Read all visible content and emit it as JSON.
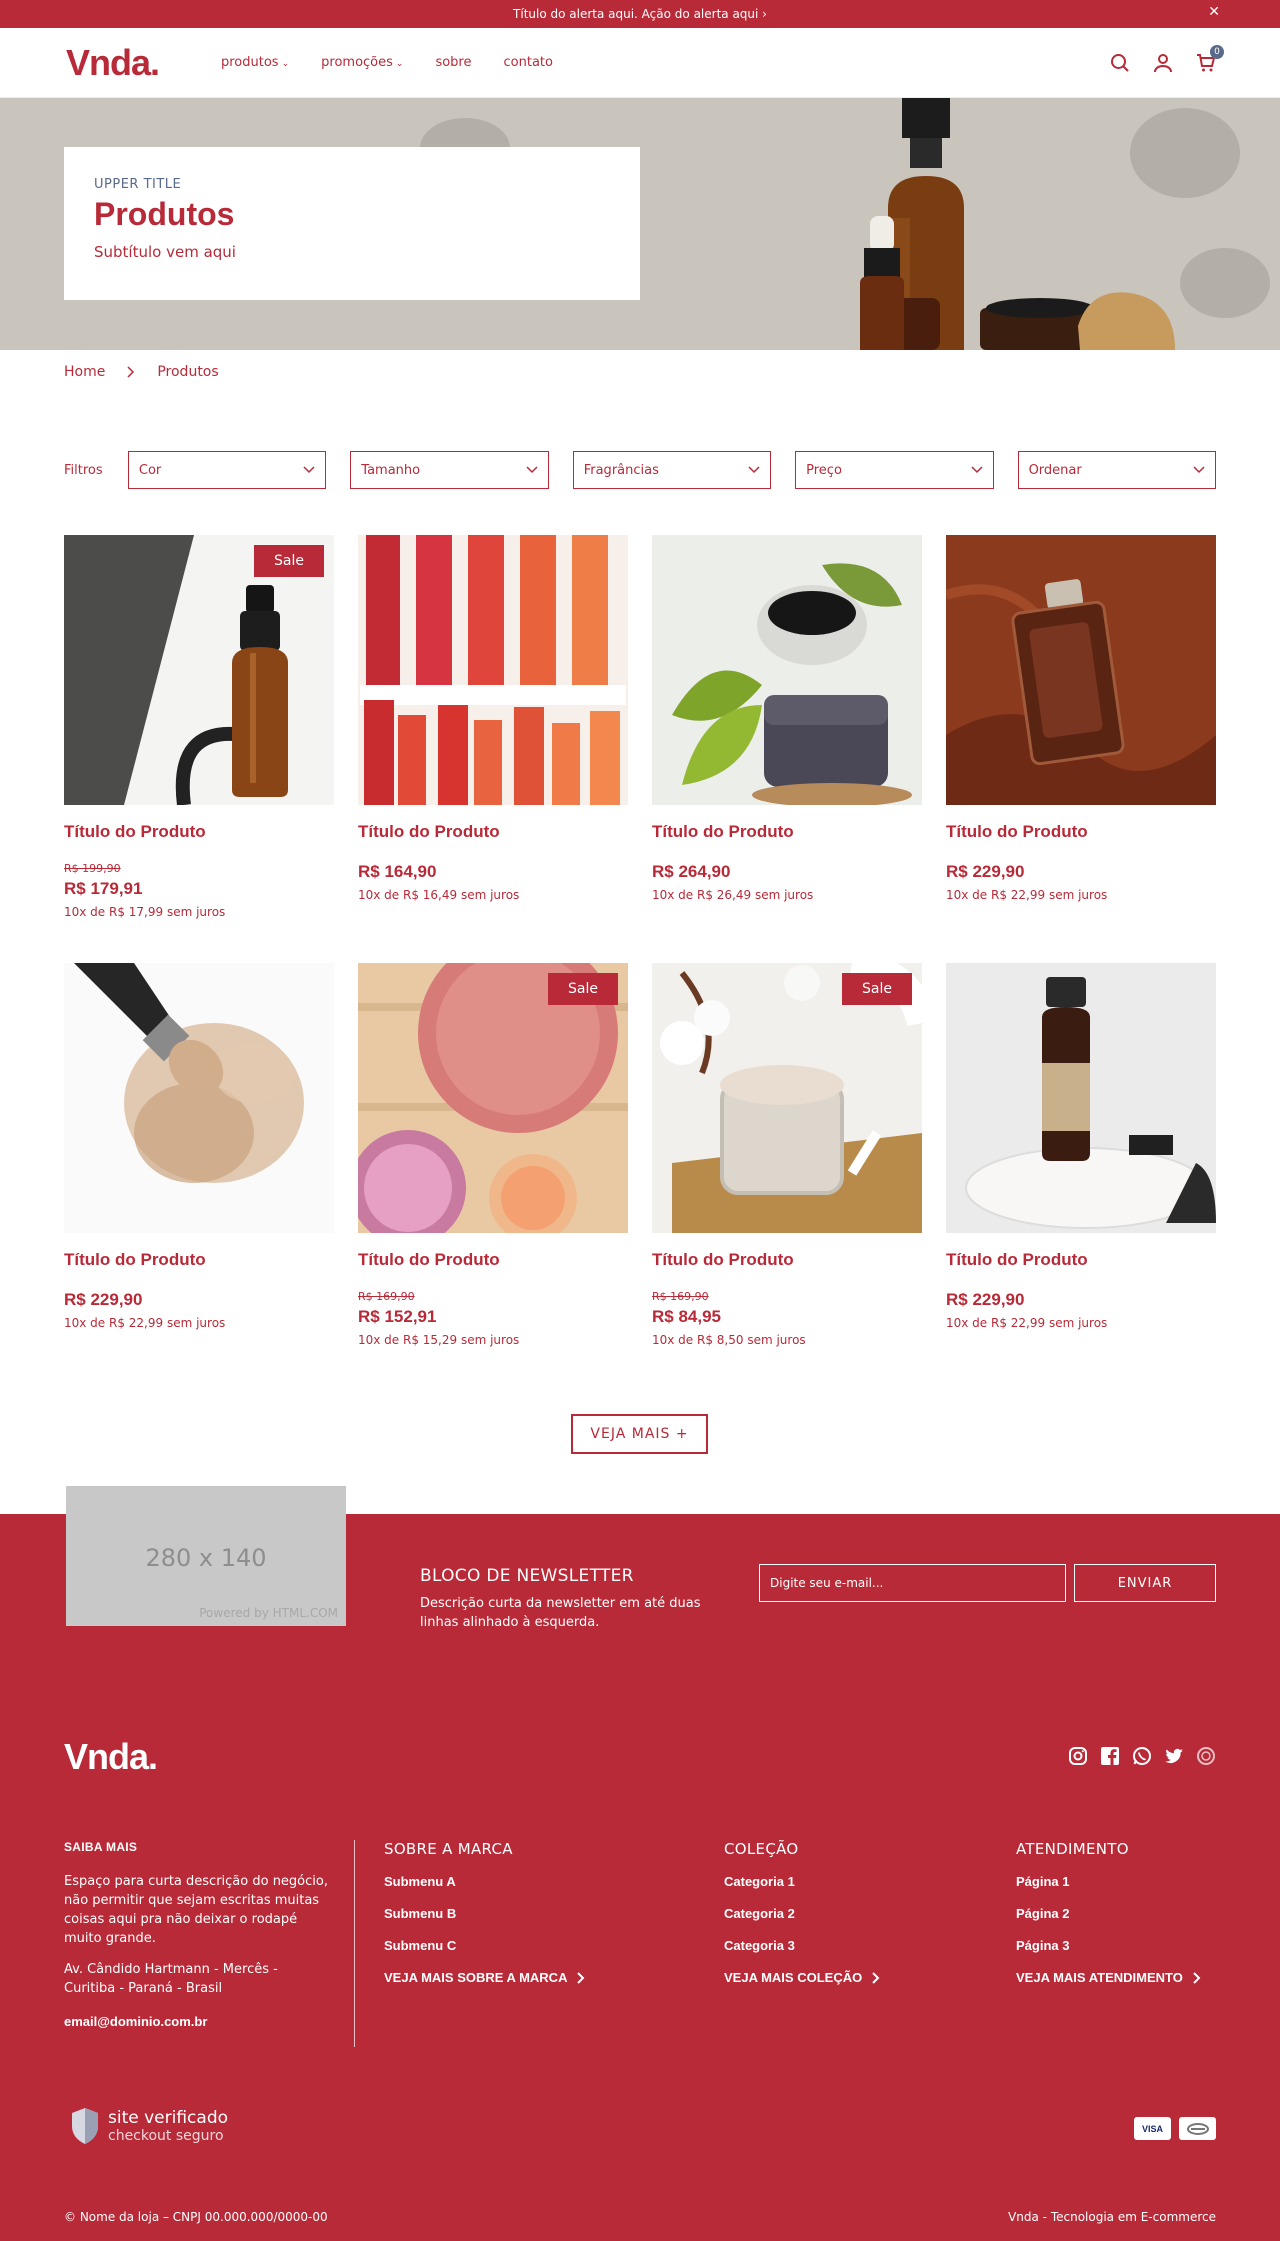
{
  "alert": {
    "text": "Título do alerta aqui. Ação do alerta aqui ›",
    "close": "✕"
  },
  "header": {
    "logo": "Vnda.",
    "nav": [
      {
        "label": "produtos",
        "dropdown": true
      },
      {
        "label": "promoções",
        "dropdown": true
      },
      {
        "label": "sobre",
        "dropdown": false
      },
      {
        "label": "contato",
        "dropdown": false
      }
    ],
    "cart_count": "0",
    "icons": [
      "search-icon",
      "user-icon",
      "cart-icon"
    ]
  },
  "hero": {
    "upper": "UPPER TITLE",
    "title": "Produtos",
    "subtitle": "Subtítulo vem aqui"
  },
  "breadcrumb": {
    "home": "Home",
    "current": "Produtos"
  },
  "filters": {
    "label": "Filtros",
    "items": [
      "Cor",
      "Tamanho",
      "Fragrâncias",
      "Preço",
      "Ordenar"
    ]
  },
  "products": [
    {
      "title": "Título do Produto",
      "sale": "Sale",
      "old_price": "R$ 199,90",
      "price": "R$ 179,91",
      "installments": "10x de R$ 17,99 sem juros",
      "image": "dropper-bottle"
    },
    {
      "title": "Título do Produto",
      "sale": "",
      "old_price": "",
      "price": "R$ 164,90",
      "installments": "10x de R$ 16,49 sem juros",
      "image": "lipsticks"
    },
    {
      "title": "Título do Produto",
      "sale": "",
      "old_price": "",
      "price": "R$ 264,90",
      "installments": "10x de R$ 26,49 sem juros",
      "image": "charcoal-soap"
    },
    {
      "title": "Título do Produto",
      "sale": "",
      "old_price": "",
      "price": "R$ 229,90",
      "installments": "10x de R$ 22,99 sem juros",
      "image": "perfume"
    },
    {
      "title": "Título do Produto",
      "sale": "",
      "old_price": "",
      "price": "R$ 229,90",
      "installments": "10x de R$ 22,99 sem juros",
      "image": "powder-brush"
    },
    {
      "title": "Título do Produto",
      "sale": "Sale",
      "old_price": "R$ 169,90",
      "price": "R$ 152,91",
      "installments": "10x de R$ 15,29 sem juros",
      "image": "pigments"
    },
    {
      "title": "Título do Produto",
      "sale": "Sale",
      "old_price": "R$ 169,90",
      "price": "R$ 84,95",
      "installments": "10x de R$ 8,50 sem juros",
      "image": "scrub-jar"
    },
    {
      "title": "Título do Produto",
      "sale": "",
      "old_price": "",
      "price": "R$ 229,90",
      "installments": "10x de R$ 22,99 sem juros",
      "image": "amber-bottle"
    }
  ],
  "more_button": "VEJA MAIS +",
  "newsletter": {
    "image_label": "280 x 140",
    "image_powered": "Powered by HTML.COM",
    "title": "BLOCO DE NEWSLETTER",
    "desc": "Descrição curta da newsletter em até duas linhas alinhado à esquerda.",
    "placeholder": "Digite seu e-mail...",
    "button": "ENVIAR"
  },
  "footer": {
    "logo": "Vnda.",
    "socials": [
      "instagram-icon",
      "facebook-icon",
      "whatsapp-icon",
      "twitter-icon",
      "pinterest-icon"
    ],
    "about": {
      "title": "SAIBA MAIS",
      "text": "Espaço para curta descrição do negócio, não permitir que sejam escritas muitas coisas aqui pra não deixar o rodapé muito grande.",
      "address": "Av. Cândido Hartmann - Mercês - Curitiba - Paraná - Brasil",
      "email": "email@dominio.com.br"
    },
    "columns": [
      {
        "title": "SOBRE A MARCA",
        "links": [
          "Submenu A",
          "Submenu B",
          "Submenu C"
        ],
        "more": "VEJA MAIS SOBRE A MARCA"
      },
      {
        "title": "COLEÇÃO",
        "links": [
          "Categoria 1",
          "Categoria 2",
          "Categoria 3"
        ],
        "more": "VEJA MAIS COLEÇÃO"
      },
      {
        "title": "ATENDIMENTO",
        "links": [
          "Página 1",
          "Página 2",
          "Página 3"
        ],
        "more": "VEJA MAIS ATENDIMENTO"
      }
    ],
    "seal": {
      "line1": "site verificado",
      "line2": "checkout seguro"
    },
    "payments": [
      "VISA",
      "ELO"
    ],
    "copyright": "© Nome da loja – CNPJ 00.000.000/0000-00",
    "credit": "Vnda - Tecnologia em E-commerce"
  }
}
